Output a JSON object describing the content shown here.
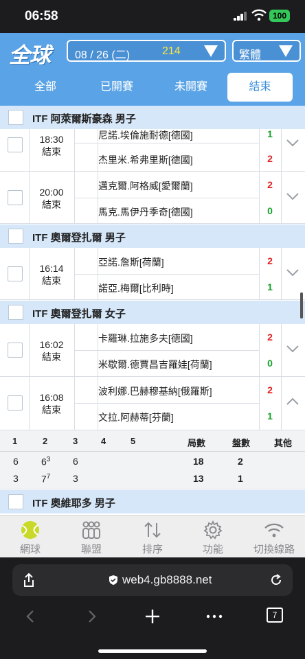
{
  "status_bar": {
    "time": "06:58",
    "battery": "100"
  },
  "header": {
    "logo": "全球",
    "date_select": {
      "date": "08 / 26 (二)",
      "count": "214"
    },
    "lang_select": {
      "value": "繁體"
    }
  },
  "tabs": [
    {
      "label": "全部",
      "active": false
    },
    {
      "label": "已開賽",
      "active": false
    },
    {
      "label": "未開賽",
      "active": false
    },
    {
      "label": "結束",
      "active": true
    }
  ],
  "sections": [
    {
      "title": "ITF 阿萊爾斯豪森 男子",
      "matches": [
        {
          "time": "18:30",
          "status": "結束",
          "player1": "尼諾.埃倫施耐德[德國]",
          "score1": "1",
          "player2": "杰里米.希弗里斯[德國]",
          "score2": "2",
          "expanded": false
        },
        {
          "time": "20:00",
          "status": "結束",
          "player1": "邁克爾.阿格威[愛爾蘭]",
          "score1": "2",
          "player2": "馬克.馬伊丹季奇[德國]",
          "score2": "0",
          "expanded": false
        }
      ]
    },
    {
      "title": "ITF 奧爾登扎爾 男子",
      "matches": [
        {
          "time": "16:14",
          "status": "結束",
          "player1": "亞諾.詹斯[荷蘭]",
          "score1": "2",
          "player2": "諾亞.梅爾[比利時]",
          "score2": "1",
          "expanded": false
        }
      ]
    },
    {
      "title": "ITF 奧爾登扎爾 女子",
      "matches": [
        {
          "time": "16:02",
          "status": "結束",
          "player1": "卡羅琳.拉施多夫[德國]",
          "score1": "2",
          "player2": "米歇爾.德賈昌吉羅娃[荷蘭]",
          "score2": "0",
          "expanded": false
        },
        {
          "time": "16:08",
          "status": "結束",
          "player1": "波利娜.巴赫穆基納[俄羅斯]",
          "score1": "2",
          "player2": "文拉.阿赫蒂[芬蘭]",
          "score2": "1",
          "expanded": true
        }
      ]
    },
    {
      "title": "ITF 奧維耶多 男子",
      "matches": []
    }
  ],
  "score_table": {
    "headers": [
      "1",
      "2",
      "3",
      "4",
      "5",
      "局數",
      "盤數",
      "其他"
    ],
    "rows": [
      {
        "sets": [
          "6",
          "6",
          "6"
        ],
        "set2_tiebreak": "3",
        "games": "18",
        "sets_won": "2"
      },
      {
        "sets": [
          "3",
          "7",
          "3"
        ],
        "set2_tiebreak": "7",
        "games": "13",
        "sets_won": "1"
      }
    ]
  },
  "bottom_nav": [
    {
      "label": "網球",
      "icon": "tennis-ball-icon",
      "active": true
    },
    {
      "label": "聯盟",
      "icon": "league-icon",
      "active": false
    },
    {
      "label": "排序",
      "icon": "sort-icon",
      "active": false
    },
    {
      "label": "功能",
      "icon": "gear-icon",
      "active": false
    },
    {
      "label": "切換線路",
      "icon": "wifi-icon",
      "active": false
    }
  ],
  "browser": {
    "url": "web4.gb8888.net",
    "tab_count": "7"
  },
  "colors": {
    "header_blue": "#5aa3e6",
    "section_bg": "#d5e7f9",
    "score_red": "#e02020",
    "score_green": "#16a02a",
    "tennis_ball": "#c8d92a"
  }
}
